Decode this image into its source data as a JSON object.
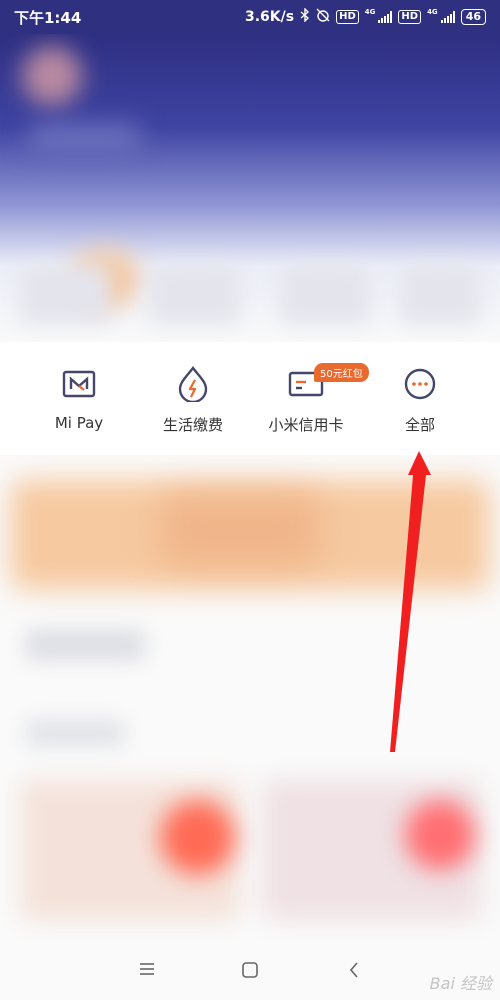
{
  "status_bar": {
    "time": "下午1:44",
    "network_speed": "3.6K/s",
    "hd_label": "HD",
    "signal_type": "4G",
    "battery": "46"
  },
  "quick_actions": [
    {
      "label": "Mi Pay",
      "icon": "mi-pay-icon"
    },
    {
      "label": "生活缴费",
      "icon": "bill-payment-icon"
    },
    {
      "label": "小米信用卡",
      "icon": "credit-card-icon",
      "badge": "50元红包"
    },
    {
      "label": "全部",
      "icon": "more-icon"
    }
  ],
  "colors": {
    "header": "#2f3180",
    "accent": "#e86a2f",
    "icon": "#44476a",
    "annotation_arrow": "#f02020"
  },
  "watermark": "Bai 经验"
}
